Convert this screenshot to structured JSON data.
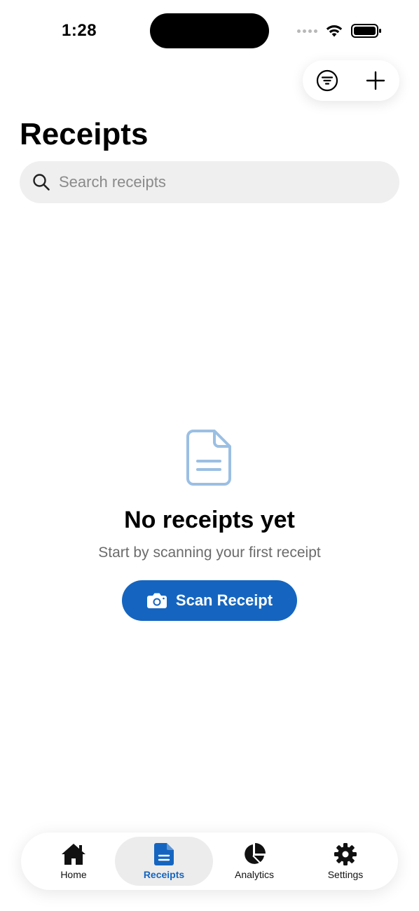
{
  "status_bar": {
    "time": "1:28"
  },
  "toolbar": {
    "filter_icon": "filter-icon",
    "add_icon": "plus-icon"
  },
  "header": {
    "title": "Receipts"
  },
  "search": {
    "placeholder": "Search receipts",
    "value": ""
  },
  "empty_state": {
    "icon": "document-icon",
    "title": "No receipts yet",
    "subtitle": "Start by scanning your first receipt",
    "button_label": "Scan Receipt"
  },
  "tab_bar": {
    "tabs": [
      {
        "label": "Home",
        "icon": "home-icon",
        "active": false
      },
      {
        "label": "Receipts",
        "icon": "receipt-icon",
        "active": true
      },
      {
        "label": "Analytics",
        "icon": "pie-chart-icon",
        "active": false
      },
      {
        "label": "Settings",
        "icon": "gear-icon",
        "active": false
      }
    ]
  },
  "colors": {
    "accent": "#1565c0",
    "icon_light": "#9bbfe3",
    "search_bg": "#efefef"
  }
}
